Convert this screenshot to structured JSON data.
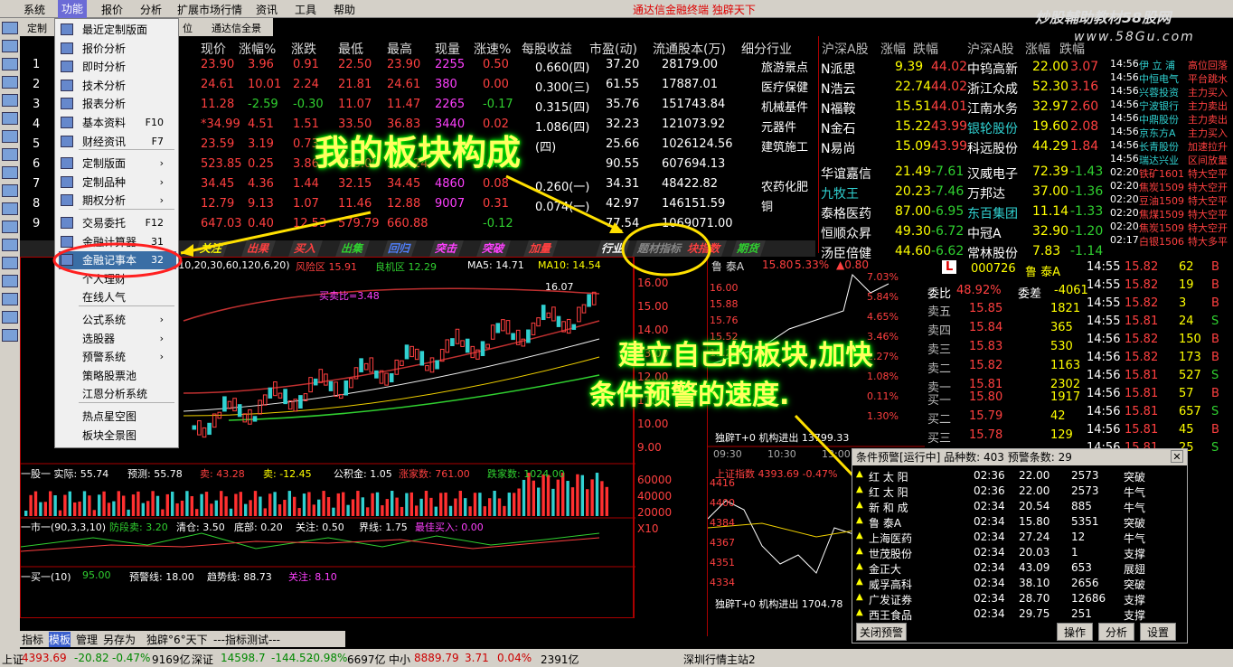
{
  "menu": [
    "系统",
    "功能",
    "报价",
    "分析",
    "扩展市场行情",
    "资讯",
    "工具",
    "帮助"
  ],
  "center_title": "通达信金融终端  独辟天下",
  "watermark": "炒股輔助教材58股网",
  "watermark_url": "www.58Gu.com",
  "top_tabs": [
    "定制",
    "位",
    "通达信全景"
  ],
  "quote_headers": [
    "现价",
    "涨幅%",
    "涨跌",
    "最低",
    "最高",
    "现量",
    "涨速%",
    "每股收益",
    "市盈(动)",
    "流通股本(万)",
    "细分行业"
  ],
  "quote_rows": [
    {
      "n": "1",
      "c": [
        "23.90",
        "3.96",
        "0.91",
        "22.50",
        "23.90",
        "2255",
        "0.50",
        "0.660(四)",
        "37.20",
        "28179.00",
        "旅游景点"
      ]
    },
    {
      "n": "2",
      "c": [
        "24.61",
        "10.01",
        "2.24",
        "21.81",
        "24.61",
        "380",
        "0.00",
        "0.300(三)",
        "61.55",
        "17887.01",
        "医疗保健"
      ]
    },
    {
      "n": "3",
      "c": [
        "11.28",
        "-2.59",
        "-0.30",
        "11.07",
        "11.47",
        "2265",
        "-0.17",
        "0.315(四)",
        "35.76",
        "151743.84",
        "机械基件"
      ]
    },
    {
      "n": "4",
      "c": [
        "*34.99",
        "4.51",
        "1.51",
        "33.50",
        "36.83",
        "3440",
        "0.02",
        "1.086(四)",
        "32.23",
        "121073.92",
        "元器件"
      ]
    },
    {
      "n": "5",
      "c": [
        "23.59",
        "3.19",
        "0.73",
        "",
        "",
        "",
        "",
        "(四)",
        "25.66",
        "1026124.56",
        "建筑施工"
      ]
    },
    {
      "n": "6",
      "c": [
        "523.85",
        "0.25",
        "3.86",
        "496.00",
        "550.24",
        "",
        "-0.11",
        "",
        "90.55",
        "607694.13",
        ""
      ]
    },
    {
      "n": "7",
      "c": [
        "34.45",
        "4.36",
        "1.44",
        "32.15",
        "34.45",
        "4860",
        "0.08",
        "0.260(一)",
        "34.31",
        "48422.82",
        "农药化肥"
      ]
    },
    {
      "n": "8",
      "c": [
        "12.79",
        "9.13",
        "1.07",
        "11.46",
        "12.88",
        "9007",
        "0.31",
        "0.074(一)",
        "42.97",
        "146151.59",
        "铜"
      ]
    },
    {
      "n": "9",
      "c": [
        "647.03",
        "0.40",
        "12.53",
        "579.79",
        "660.88",
        "",
        "-0.12",
        "",
        "77.54",
        "1069071.00",
        ""
      ]
    }
  ],
  "rank_headers": [
    "沪深A股",
    "涨幅",
    "跌幅",
    "沪深A股",
    "涨幅",
    "跌幅"
  ],
  "rank_rows": [
    [
      "N派思",
      "9.39",
      "44.02",
      "中钨高新",
      "22.00",
      "3.07"
    ],
    [
      "N浩云",
      "22.74",
      "44.02",
      "浙江众成",
      "52.30",
      "3.16"
    ],
    [
      "N福鞍",
      "15.51",
      "44.01",
      "江南水务",
      "32.97",
      "2.60"
    ],
    [
      "N金石",
      "15.22",
      "43.99",
      "银轮股份",
      "19.60",
      "2.08"
    ],
    [
      "N易尚",
      "15.09",
      "43.99",
      "科远股份",
      "44.29",
      "1.84"
    ],
    [
      "华谊嘉信",
      "21.49",
      "-7.61",
      "汉威电子",
      "72.39",
      "-1.43"
    ],
    [
      "九牧王",
      "20.23",
      "-7.46",
      "万邦达",
      "37.00",
      "-1.36"
    ],
    [
      "泰格医药",
      "87.00",
      "-6.95",
      "东百集团",
      "11.14",
      "-1.33"
    ],
    [
      "恒顺众昇",
      "49.30",
      "-6.72",
      "中冠A",
      "32.90",
      "-1.20"
    ],
    [
      "汤臣倍健",
      "44.60",
      "-6.62",
      "常林股份",
      "7.83",
      "-1.14"
    ]
  ],
  "ticks": [
    [
      "14:56",
      "伊 立 浦",
      "高位回落"
    ],
    [
      "14:56",
      "中恒电气",
      "平台跳水"
    ],
    [
      "14:56",
      "兴蓉投资",
      "主力买入"
    ],
    [
      "14:56",
      "宁波银行",
      "主力卖出"
    ],
    [
      "14:56",
      "中鼎股份",
      "主力卖出"
    ],
    [
      "14:56",
      "京东方A",
      "主力买入"
    ],
    [
      "14:56",
      "长青股份",
      "加速拉升"
    ],
    [
      "14:56",
      "瑞达兴业",
      "区间放量"
    ],
    [
      "02:20",
      "铁矿1601",
      "特大空平"
    ],
    [
      "02:20",
      "焦炭1509",
      "特大空开"
    ],
    [
      "02:20",
      "豆油1509",
      "特大空平"
    ],
    [
      "02:20",
      "焦煤1509",
      "特大空平"
    ],
    [
      "02:20",
      "焦炭1509",
      "特大空开"
    ],
    [
      "02:17",
      "白银1506",
      "特大多平"
    ]
  ],
  "boards": [
    "关注",
    "出果",
    "买入",
    "出集",
    "回归",
    "突击",
    "突破",
    "加量",
    "行业",
    "题材指标",
    "块指数",
    "期货"
  ],
  "dropdown": [
    {
      "label": "最近定制版面",
      "key": ""
    },
    {
      "label": "报价分析",
      "key": ""
    },
    {
      "label": "即时分析",
      "key": ""
    },
    {
      "label": "技术分析",
      "key": ""
    },
    {
      "label": "报表分析",
      "key": ""
    },
    {
      "label": "基本资料",
      "key": "F10"
    },
    {
      "label": "财经资讯",
      "key": "F7"
    },
    {
      "label": "定制版面",
      "key": "›"
    },
    {
      "label": "定制品种",
      "key": "›"
    },
    {
      "label": "期权分析",
      "key": "›"
    },
    {
      "label": "交易委托",
      "key": "F12"
    },
    {
      "label": "金融计算器",
      "key": "31"
    },
    {
      "label": "金融记事本",
      "key": "32"
    },
    {
      "label": "个人理财",
      "key": ""
    },
    {
      "label": "在线人气",
      "key": ""
    },
    {
      "label": "公式系统",
      "key": "›"
    },
    {
      "label": "选股器",
      "key": "›"
    },
    {
      "label": "预警系统",
      "key": "›"
    },
    {
      "label": "策略股票池",
      "key": ""
    },
    {
      "label": "江恩分析系统",
      "key": ""
    },
    {
      "label": "热点星空图",
      "key": ""
    },
    {
      "label": "板块全景图",
      "key": ""
    }
  ],
  "chart_info": {
    "ma": "(10,20,30,60,120,6,20)",
    "risk": "风险区 15.91",
    "good": "良机区 12.29",
    "ma5": "MA5: 14.71",
    "ma10": "MA10: 14.54",
    "buysell": "买卖比=3.48",
    "peak": "16.07",
    "yaxis": [
      "16.00",
      "15.00",
      "14.00",
      "13.00",
      "12.00",
      "11.00",
      "10.00",
      "9.00"
    ],
    "vol_labels": [
      "60000",
      "40000",
      "20000",
      "X10"
    ]
  },
  "ind1": {
    "a": "一股一 实际: 55.74",
    "b": "预测: 55.78",
    "c": "卖: 43.28",
    "d": "卖: -12.45",
    "e": "公积金: 1.05",
    "f": "涨家数: 761.00",
    "g": "跌家数: 1024.00"
  },
  "ind2": {
    "a": "一市一(90,3,3,10)",
    "b": "防段卖: 3.20",
    "c": "清仓: 3.50",
    "d": "底部: 0.20",
    "e": "关注: 0.50",
    "f": "界线: 1.75",
    "g": "最佳买入: 0.00"
  },
  "ind3": {
    "a": "一买一(10)",
    "b": "95.00",
    "c": "预警线: 18.00",
    "d": "趋势线: 88.73",
    "e": "关注: 8.10"
  },
  "stock": {
    "code": "000726",
    "name": "鲁 泰A",
    "price": "15.80",
    "pct": "5.33%",
    "chg": "▲0.80",
    "webi_label": "委比",
    "webi": "48.92%",
    "wecha_label": "委差",
    "wecha": "-4061"
  },
  "mini_y": [
    "7.03%",
    "5.84%",
    "4.65%",
    "3.46%",
    "2.27%",
    "1.08%",
    "0.11%",
    "1.30%"
  ],
  "mini_price": [
    "16.00",
    "15.88",
    "15.76",
    "15.52",
    "15.28"
  ],
  "asks": [
    [
      "卖五",
      "15.85",
      "1821"
    ],
    [
      "卖四",
      "15.84",
      "365"
    ],
    [
      "卖三",
      "15.83",
      "530"
    ],
    [
      "卖二",
      "15.82",
      "1163"
    ],
    [
      "卖一",
      "15.81",
      "2302"
    ]
  ],
  "bids": [
    [
      "买一",
      "15.80",
      "1917"
    ],
    [
      "买二",
      "15.79",
      "42"
    ],
    [
      "买三",
      "15.78",
      "129"
    ]
  ],
  "trades": [
    [
      "14:55",
      "15.82",
      "62",
      "B"
    ],
    [
      "14:55",
      "15.82",
      "19",
      "B"
    ],
    [
      "14:55",
      "15.82",
      "3",
      "B"
    ],
    [
      "14:55",
      "15.81",
      "24",
      "S"
    ],
    [
      "14:56",
      "15.82",
      "150",
      "B"
    ],
    [
      "14:56",
      "15.82",
      "173",
      "B"
    ],
    [
      "14:56",
      "15.81",
      "527",
      "S"
    ],
    [
      "14:56",
      "15.81",
      "57",
      "B"
    ],
    [
      "14:56",
      "15.81",
      "657",
      "S"
    ],
    [
      "14:56",
      "15.81",
      "45",
      "B"
    ],
    [
      "14:56",
      "15.81",
      "25",
      "S"
    ]
  ],
  "warn": {
    "title": "条件预警[运行中] 品种数: 403  预警条数: 29",
    "rows": [
      [
        "红 太 阳",
        "02:36",
        "22.00",
        "2573",
        "突破"
      ],
      [
        "红 太 阳",
        "02:36",
        "22.00",
        "2573",
        "牛气"
      ],
      [
        "新 和 成",
        "02:34",
        "20.54",
        "885",
        "牛气"
      ],
      [
        "鲁 泰A",
        "02:34",
        "15.80",
        "5351",
        "突破"
      ],
      [
        "上海医药",
        "02:34",
        "27.24",
        "12",
        "牛气"
      ],
      [
        "世茂股份",
        "02:34",
        "20.03",
        "1",
        "支撑"
      ],
      [
        "金正大",
        "02:34",
        "43.09",
        "653",
        "展翅"
      ],
      [
        "威孚高科",
        "02:34",
        "38.10",
        "2656",
        "突破"
      ],
      [
        "广发证券",
        "02:34",
        "28.70",
        "12686",
        "支撑"
      ],
      [
        "西王食品",
        "02:34",
        "29.75",
        "251",
        "支撑"
      ]
    ],
    "close": "关闭预警",
    "op": "操作",
    "analyze": "分析",
    "settings": "设置"
  },
  "bottom_tabs": [
    "指标",
    "模板",
    "管理",
    "另存为",
    "独辟°6°天下",
    "---指标测试---"
  ],
  "status": [
    "上证",
    "4393.69",
    "-20.82",
    "-0.47%",
    "9169亿",
    "深证",
    "14598.7",
    "-144.52",
    "-0.98%",
    "6697亿",
    "中小",
    "8889.79",
    "3.71",
    "0.04%",
    "2391亿",
    "深圳行情主站2"
  ],
  "mini_ind": {
    "t1": "独辟T+0 机构进出 13799.33",
    "t2": "上证指数 4393.69 -0.47%",
    "t3": "独辟T+0 机构进出 1704.78",
    "times": [
      "09:30",
      "10:30",
      "13:00",
      "14:00"
    ],
    "mini2_y": [
      "4416",
      "4400",
      "4384",
      "4367",
      "4351",
      "4334"
    ]
  },
  "annotations": {
    "a1": "我的板块构成",
    "a2": "建立自己的板块,加快",
    "a3": "条件预警的速度."
  },
  "colors": {
    "up": "#ff4040",
    "down": "#30d030",
    "accent": "#ffff00"
  }
}
